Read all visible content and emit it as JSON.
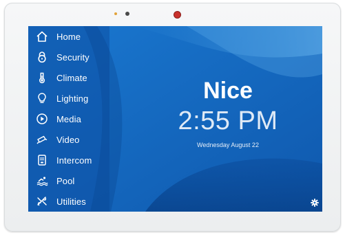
{
  "menu": {
    "items": [
      {
        "label": "Home",
        "icon": "home-icon"
      },
      {
        "label": "Security",
        "icon": "lock-icon"
      },
      {
        "label": "Climate",
        "icon": "thermometer-icon"
      },
      {
        "label": "Lighting",
        "icon": "lightbulb-icon"
      },
      {
        "label": "Media",
        "icon": "play-icon"
      },
      {
        "label": "Video",
        "icon": "camera-icon"
      },
      {
        "label": "Intercom",
        "icon": "intercom-icon"
      },
      {
        "label": "Pool",
        "icon": "swimmer-icon"
      },
      {
        "label": "Utilities",
        "icon": "utilities-icon"
      }
    ]
  },
  "main": {
    "brand": "Nice",
    "time": "2:55 PM",
    "date": "Wednesday August 22"
  },
  "footer": {
    "settings_icon": "gear-icon"
  },
  "colors": {
    "screen_blue": "#1569c0",
    "sidebar_blue": "#0d4fa3",
    "text_white": "#ffffff"
  }
}
